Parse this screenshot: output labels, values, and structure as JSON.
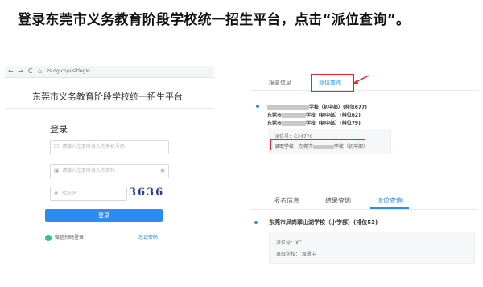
{
  "heading": "登录东莞市义务教育阶段学校统一招生平台，点击“派位查询”。",
  "browser": {
    "back": "←",
    "forward": "→",
    "reload": "C",
    "url": "zs.dg.cn/visitlogin",
    "site_title": "东莞市义务教育阶段学校统一招生平台",
    "login_title": "登录",
    "phone_placeholder": "请输入注册时录入的手机号码",
    "password_placeholder": "请输入注册时录入的密码",
    "captcha_placeholder": "验证码",
    "captcha_value": "3636",
    "login_button": "登录",
    "wechat_login": "微信扫码登录",
    "forgot_password": "忘记密码"
  },
  "panel_a": {
    "tabs": [
      "报名信息",
      "派位查询"
    ],
    "line1": "学校（初中部）(排位677)",
    "line2_prefix": "东莞市",
    "line2": "学校（初中部）(排位62)",
    "line3_prefix": "东莞市",
    "line3": "学校（初中部）(排位79)",
    "card_number": "派位号：C34770",
    "card_school_prefix": "录取学校：",
    "card_school_mid": "东莞市",
    "card_school_suffix": "学校（初中部）"
  },
  "panel_b": {
    "tabs": [
      "报名信息",
      "结果查询",
      "派位查询"
    ],
    "school": "东莞市凤岗翠山湖学校（小学部）(排位53)",
    "number_label": "派位号：XC",
    "admission": "录取学校：  派遣中"
  },
  "colors": {
    "accent": "#2d8cf0",
    "highlight": "#e0292b",
    "login_button": "#2d8cf0",
    "captcha": "#2b3f8f"
  }
}
